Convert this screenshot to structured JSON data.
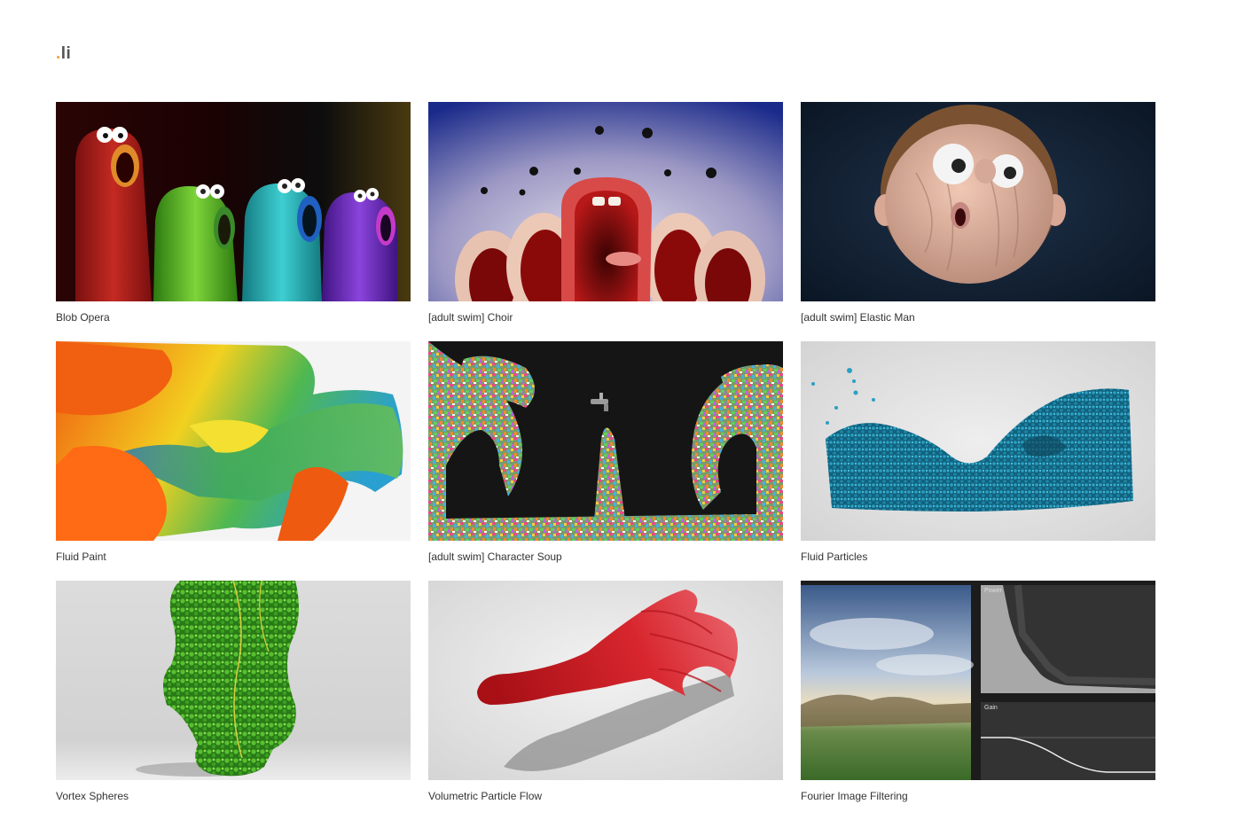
{
  "logo": {
    "dot": ".",
    "text": "li"
  },
  "projects": [
    {
      "title": "Blob Opera"
    },
    {
      "title": "[adult swim] Choir"
    },
    {
      "title": "[adult swim] Elastic Man"
    },
    {
      "title": "Fluid Paint"
    },
    {
      "title": "[adult swim] Character Soup"
    },
    {
      "title": "Fluid Particles"
    },
    {
      "title": "Vortex Spheres"
    },
    {
      "title": "Volumetric Particle Flow"
    },
    {
      "title": "Fourier Image Filtering",
      "panels": {
        "power": "Power",
        "gain": "Gain"
      }
    }
  ]
}
